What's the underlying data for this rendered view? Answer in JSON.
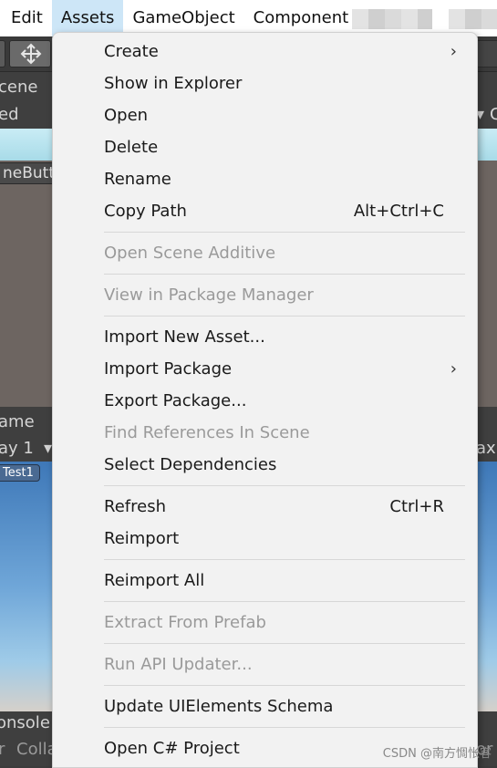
{
  "menubar": {
    "items": [
      "Edit",
      "Assets",
      "GameObject",
      "Component"
    ]
  },
  "background": {
    "scene_tab": "cene",
    "shaded": "ed",
    "scene_button": "neButt",
    "right_letter": "C",
    "game_tab": "ame",
    "display": "ay 1",
    "game_object": "Test1",
    "maximize": "axi",
    "console": "onsole",
    "collapse": "Colla",
    "right_bottom": "or"
  },
  "context_menu": {
    "items": [
      {
        "label": "Create",
        "shortcut": "",
        "submenu": true,
        "disabled": false
      },
      {
        "label": "Show in Explorer",
        "shortcut": "",
        "submenu": false,
        "disabled": false
      },
      {
        "label": "Open",
        "shortcut": "",
        "submenu": false,
        "disabled": false
      },
      {
        "label": "Delete",
        "shortcut": "",
        "submenu": false,
        "disabled": false
      },
      {
        "label": "Rename",
        "shortcut": "",
        "submenu": false,
        "disabled": false
      },
      {
        "label": "Copy Path",
        "shortcut": "Alt+Ctrl+C",
        "submenu": false,
        "disabled": false
      },
      {
        "label": "Open Scene Additive",
        "shortcut": "",
        "submenu": false,
        "disabled": true
      },
      {
        "label": "View in Package Manager",
        "shortcut": "",
        "submenu": false,
        "disabled": true
      },
      {
        "label": "Import New Asset...",
        "shortcut": "",
        "submenu": false,
        "disabled": false
      },
      {
        "label": "Import Package",
        "shortcut": "",
        "submenu": true,
        "disabled": false
      },
      {
        "label": "Export Package...",
        "shortcut": "",
        "submenu": false,
        "disabled": false
      },
      {
        "label": "Find References In Scene",
        "shortcut": "",
        "submenu": false,
        "disabled": true
      },
      {
        "label": "Select Dependencies",
        "shortcut": "",
        "submenu": false,
        "disabled": false
      },
      {
        "label": "Refresh",
        "shortcut": "Ctrl+R",
        "submenu": false,
        "disabled": false
      },
      {
        "label": "Reimport",
        "shortcut": "",
        "submenu": false,
        "disabled": false
      },
      {
        "label": "Reimport All",
        "shortcut": "",
        "submenu": false,
        "disabled": false
      },
      {
        "label": "Extract From Prefab",
        "shortcut": "",
        "submenu": false,
        "disabled": true
      },
      {
        "label": "Run API Updater...",
        "shortcut": "",
        "submenu": false,
        "disabled": true
      },
      {
        "label": "Update UIElements Schema",
        "shortcut": "",
        "submenu": false,
        "disabled": false
      },
      {
        "label": "Open C# Project",
        "shortcut": "",
        "submenu": false,
        "disabled": false
      }
    ],
    "submenu_glyph": "›"
  },
  "watermark": "CSDN @南方惆怅客",
  "colors": {
    "menu_bg": "#f2f2f2",
    "active_menu": "#cde6f7",
    "disabled_text": "#9a9a9a"
  }
}
